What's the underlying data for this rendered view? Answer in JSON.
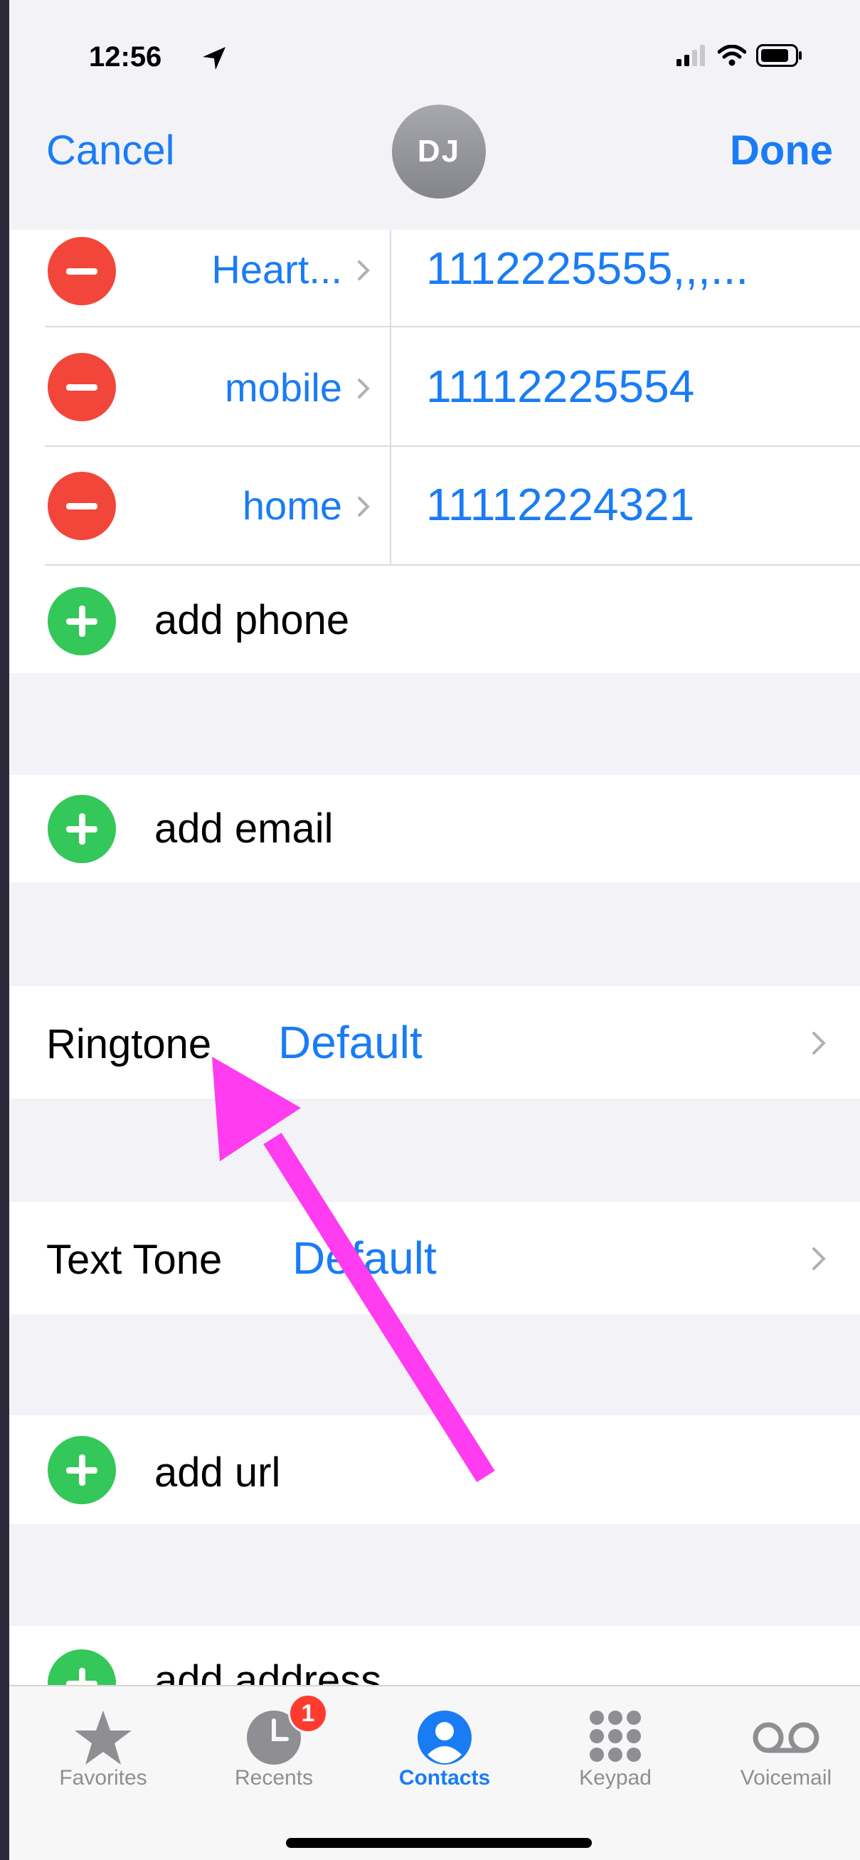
{
  "status_bar": {
    "time": "12:56"
  },
  "nav": {
    "cancel_label": "Cancel",
    "done_label": "Done",
    "avatar_initials": "DJ"
  },
  "phones": [
    {
      "label": "Heart...",
      "number": "1112225555,,,..."
    },
    {
      "label": "mobile",
      "number": "11112225554"
    },
    {
      "label": "home",
      "number": "11112224321"
    }
  ],
  "add_phone_label": "add phone",
  "add_email_label": "add email",
  "ringtone": {
    "title": "Ringtone",
    "value": "Default"
  },
  "text_tone": {
    "title": "Text Tone",
    "value": "Default"
  },
  "add_url_label": "add url",
  "add_address_label": "add address",
  "tabs": [
    {
      "label": "Favorites",
      "icon": "star-icon"
    },
    {
      "label": "Recents",
      "icon": "clock-icon",
      "badge": "1"
    },
    {
      "label": "Contacts",
      "icon": "person-circle-icon",
      "active": true
    },
    {
      "label": "Keypad",
      "icon": "keypad-icon"
    },
    {
      "label": "Voicemail",
      "icon": "voicemail-icon"
    }
  ],
  "colors": {
    "accent": "#1a7cf5",
    "delete": "#f3463a",
    "add": "#34c759",
    "annotation_arrow": "#ff3cf0",
    "badge": "#ff3b30"
  }
}
